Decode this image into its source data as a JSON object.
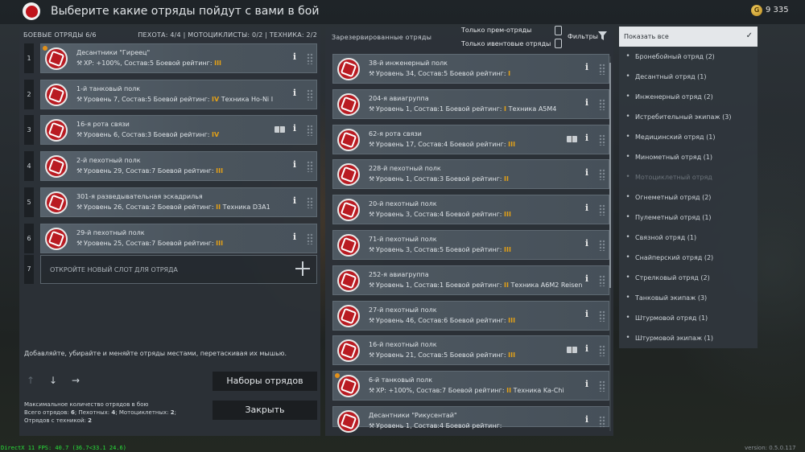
{
  "title": "Выберите какие отряды пойдут с вами в бой",
  "currency": {
    "symbol": "G",
    "amount": "9 335"
  },
  "left": {
    "header_label": "БОЕВЫЕ ОТРЯДЫ 6/6",
    "counts": "ПЕХОТА: 4/4 | МОТОЦИКЛИСТЫ: 0/2 | ТЕХНИКА: 2/2",
    "slots": [
      {
        "num": "1",
        "name": "Десантники \"Гиреец\"",
        "stat": "XP: +100%, Состав:5",
        "rating_label": "Боевой рейтинг:",
        "rating": "III",
        "extra": ""
      },
      {
        "num": "2",
        "name": "1-й танковый полк",
        "stat": "Уровень 7, Состав:5",
        "rating_label": "Боевой рейтинг:",
        "rating": "IV",
        "extra": "Техника Ho-Ni I"
      },
      {
        "num": "3",
        "name": "16-я рота связи",
        "stat": "Уровень 6, Состав:3",
        "rating_label": "Боевой рейтинг:",
        "rating": "IV",
        "extra": ""
      },
      {
        "num": "4",
        "name": "2-й пехотный полк",
        "stat": "Уровень 29, Состав:7",
        "rating_label": "Боевой рейтинг:",
        "rating": "III",
        "extra": ""
      },
      {
        "num": "5",
        "name": "301-я разведывательная эскадрилья",
        "stat": "Уровень 26, Состав:2",
        "rating_label": "Боевой рейтинг:",
        "rating": "II",
        "extra": "Техника D3A1"
      },
      {
        "num": "6",
        "name": "29-й пехотный полк",
        "stat": "Уровень 25, Состав:7",
        "rating_label": "Боевой рейтинг:",
        "rating": "III",
        "extra": ""
      }
    ],
    "new_slot_num": "7",
    "new_slot": "ОТКРОЙТЕ НОВЫЙ СЛОТ ДЛЯ ОТРЯДА",
    "hint": "Добавляйте, убирайте и меняйте отряды местами, перетаскивая их мышью.",
    "squad_sets_button": "Наборы отрядов",
    "close_button": "Закрыть",
    "max_title": "Максимальное количество отрядов в бою",
    "max_line1_a": "Всего отрядов: ",
    "max_total": "6",
    "max_line1_b": "; Пехотных: ",
    "max_inf": "4",
    "max_line1_c": "; Мотоциклетных: ",
    "max_moto": "2",
    "max_line1_d": ";",
    "max_line2_a": "Отрядов с техникой: ",
    "max_veh": "2"
  },
  "mid": {
    "header_label": "Зарезервированные отряды",
    "prem_only": "Только прем-отряды",
    "event_only": "Только ивентовые отряды",
    "filters_label": "Фильтры",
    "rating_label": "Боевой рейтинг:",
    "items": [
      {
        "name": "38-й инженерный полк",
        "stat": "Уровень 34, Состав:5",
        "rating": "I",
        "extra": ""
      },
      {
        "name": "204-я авиагруппа",
        "stat": "Уровень 1, Состав:1",
        "rating": "I",
        "extra": "Техника A5M4"
      },
      {
        "name": "62-я рота связи",
        "stat": "Уровень 17, Состав:4",
        "rating": "III",
        "extra": ""
      },
      {
        "name": "228-й пехотный полк",
        "stat": "Уровень 1, Состав:3",
        "rating": "II",
        "extra": ""
      },
      {
        "name": "20-й пехотный полк",
        "stat": "Уровень 3, Состав:4",
        "rating": "III",
        "extra": ""
      },
      {
        "name": "71-й пехотный полк",
        "stat": "Уровень 3, Состав:5",
        "rating": "III",
        "extra": ""
      },
      {
        "name": "252-я авиагруппа",
        "stat": "Уровень 1, Состав:1",
        "rating": "II",
        "extra": "Техника A6M2 Reisen"
      },
      {
        "name": "27-й пехотный полк",
        "stat": "Уровень 46, Состав:6",
        "rating": "III",
        "extra": ""
      },
      {
        "name": "16-й пехотный полк",
        "stat": "Уровень 21, Состав:5",
        "rating": "III",
        "extra": ""
      },
      {
        "name": "6-й танковый полк",
        "stat": "XP: +100%, Состав:7",
        "rating": "II",
        "extra": "Техника Ka-Chi"
      },
      {
        "name": "Десантники \"Рикусентай\"",
        "stat": "Уровень 1, Состав:4",
        "rating": "",
        "extra": ""
      }
    ]
  },
  "filters": [
    {
      "label": "Показать все",
      "icon": "check-icon"
    },
    {
      "label": "Бронебойный отряд (2)",
      "icon": "rifle-icon"
    },
    {
      "label": "Десантный отряд (1)",
      "icon": "parachute-icon"
    },
    {
      "label": "Инженерный отряд (2)",
      "icon": "wrench-icon"
    },
    {
      "label": "Истребительный экипаж (3)",
      "icon": "plane-icon"
    },
    {
      "label": "Медицинский отряд (1)",
      "icon": "medic-icon"
    },
    {
      "label": "Минометный отряд (1)",
      "icon": "mortar-icon"
    },
    {
      "label": "Мотоциклетный отряд",
      "icon": "motorcycle-icon"
    },
    {
      "label": "Огнеметный отряд (2)",
      "icon": "flame-icon"
    },
    {
      "label": "Пулеметный отряд (1)",
      "icon": "machinegun-icon"
    },
    {
      "label": "Связной отряд (1)",
      "icon": "headset-icon"
    },
    {
      "label": "Снайперский отряд (2)",
      "icon": "crosshair-icon"
    },
    {
      "label": "Стрелковый отряд (2)",
      "icon": "rifle-icon"
    },
    {
      "label": "Танковый экипаж (3)",
      "icon": "tank-icon"
    },
    {
      "label": "Штурмовой отряд (1)",
      "icon": "smg-icon"
    },
    {
      "label": "Штурмовой экипаж (1)",
      "icon": "attack-plane-icon"
    }
  ],
  "fps": "DirectX 11 FPS: 40.7 (36.7<33.1 24.6)",
  "version": "version: 0.5.0.117"
}
